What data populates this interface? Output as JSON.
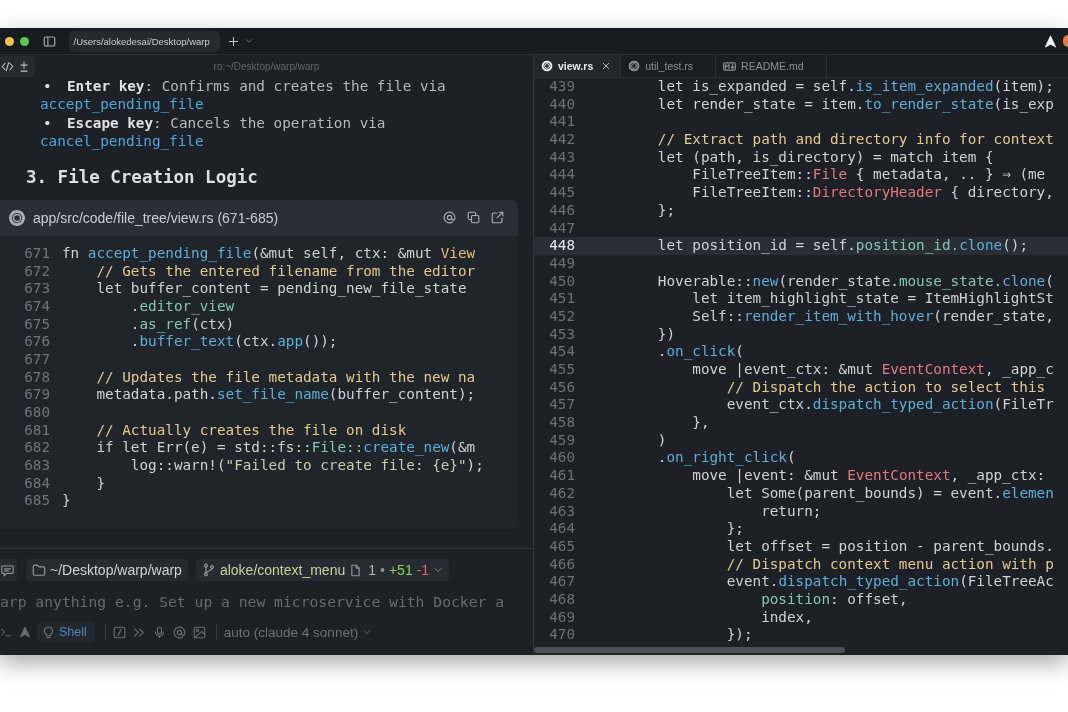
{
  "title_bar": {
    "tab_title": "/Users/alokedesai/Desktop/warp"
  },
  "left_pane": {
    "title": "ro:~/Desktop/warp/warp",
    "bullets": [
      {
        "marker": "•",
        "text": "**Enter key**: Confirms and creates the file via",
        "code": "accept_pending_file"
      },
      {
        "marker": "•",
        "text": "**Escape key**: Cancels the operation via",
        "code": "cancel_pending_file"
      }
    ],
    "heading": "3. File Creation Logic",
    "code_block": {
      "path": "app/src/code/file_tree/view.rs (671-685)",
      "lines": [
        {
          "number": "671",
          "tokens": [
            {
              "kind": "plain",
              "text": "fn "
            },
            {
              "kind": "call",
              "text": "accept_pending_file"
            },
            {
              "kind": "plain",
              "text": "(&mut self, ctx: &mut "
            },
            {
              "kind": "struct",
              "text": "View"
            }
          ]
        },
        {
          "number": "672",
          "tokens": [
            {
              "kind": "comment",
              "text": "    // Gets the entered filename from the editor"
            }
          ]
        },
        {
          "number": "673",
          "tokens": [
            {
              "kind": "plain",
              "text": "    let buffer_content = pending_new_file_state"
            }
          ]
        },
        {
          "number": "674",
          "tokens": [
            {
              "kind": "plain",
              "text": "        ."
            },
            {
              "kind": "field",
              "text": "editor_view"
            }
          ]
        },
        {
          "number": "675",
          "tokens": [
            {
              "kind": "plain",
              "text": "        ."
            },
            {
              "kind": "field",
              "text": "as_ref"
            },
            {
              "kind": "plain",
              "text": "(ctx)"
            }
          ]
        },
        {
          "number": "676",
          "tokens": [
            {
              "kind": "plain",
              "text": "        ."
            },
            {
              "kind": "call",
              "text": "buffer_text"
            },
            {
              "kind": "plain",
              "text": "(ctx."
            },
            {
              "kind": "call",
              "text": "app"
            },
            {
              "kind": "plain",
              "text": "());"
            }
          ]
        },
        {
          "number": "677"
        },
        {
          "number": "678",
          "tokens": [
            {
              "kind": "comment",
              "text": "    // Updates the file metadata with the new na"
            }
          ]
        },
        {
          "number": "679",
          "tokens": [
            {
              "kind": "plain",
              "text": "    metadata.path."
            },
            {
              "kind": "call",
              "text": "set_file_name"
            },
            {
              "kind": "plain",
              "text": "(buffer_content);"
            }
          ]
        },
        {
          "number": "680"
        },
        {
          "number": "681",
          "tokens": [
            {
              "kind": "comment",
              "text": "    // Actually creates the file on disk"
            }
          ]
        },
        {
          "number": "682",
          "tokens": [
            {
              "kind": "plain",
              "text": "    if let Err(e) = std::fs::"
            },
            {
              "kind": "field",
              "text": "File::"
            },
            {
              "kind": "call",
              "text": "create_new"
            },
            {
              "kind": "plain",
              "text": "(&m"
            }
          ]
        },
        {
          "number": "683",
          "tokens": [
            {
              "kind": "plain",
              "text": "        log::warn!("
            },
            {
              "kind": "string",
              "text": "\"Failed to create file: {e}\""
            },
            {
              "kind": "plain",
              "text": ");"
            }
          ]
        },
        {
          "number": "684",
          "tokens": [
            {
              "kind": "plain",
              "text": "    }"
            }
          ]
        },
        {
          "number": "685",
          "tokens": [
            {
              "kind": "plain",
              "text": "}"
            }
          ]
        }
      ]
    }
  },
  "prompt": {
    "directory": "~/Desktop/warp/warp",
    "git": {
      "branch": "aloke/context_menu",
      "files_changed": "1",
      "separator": "•",
      "additions": "+51",
      "deletions": "-1"
    },
    "placeholder": "arp anything e.g. Set up a new microservice with Docker a",
    "mode": "Shell",
    "model": "auto (claude 4 sonnet)"
  },
  "editor": {
    "tabs": [
      {
        "label": "view.rs",
        "selected": true,
        "kind": "rust"
      },
      {
        "label": "util_test.rs",
        "selected": false,
        "kind": "rust"
      },
      {
        "label": "README.md",
        "selected": false,
        "kind": "markdown"
      }
    ],
    "lines": [
      {
        "number": "439",
        "current": false,
        "tokens": [
          {
            "kind": "plain",
            "text": "        let is_expanded = self."
          },
          {
            "kind": "call",
            "text": "is_item_expanded"
          },
          {
            "kind": "plain",
            "text": "(item);"
          }
        ]
      },
      {
        "number": "440",
        "current": false,
        "tokens": [
          {
            "kind": "plain",
            "text": "        let render_state = item."
          },
          {
            "kind": "call",
            "text": "to_render_state"
          },
          {
            "kind": "plain",
            "text": "(is_exp"
          }
        ]
      },
      {
        "number": "441",
        "current": false
      },
      {
        "number": "442",
        "current": false,
        "tokens": [
          {
            "kind": "comment",
            "text": "        // Extract path and directory info for context"
          }
        ]
      },
      {
        "number": "443",
        "current": false,
        "tokens": [
          {
            "kind": "plain",
            "text": "        let (path, is_directory) = match item {"
          }
        ]
      },
      {
        "number": "444",
        "current": false,
        "tokens": [
          {
            "kind": "plain",
            "text": "            FileTreeItem::"
          },
          {
            "kind": "type",
            "text": "File"
          },
          {
            "kind": "plain",
            "text": " { metadata, .. } ⇒ (me"
          }
        ]
      },
      {
        "number": "445",
        "current": false,
        "tokens": [
          {
            "kind": "plain",
            "text": "            FileTreeItem::"
          },
          {
            "kind": "type",
            "text": "DirectoryHeader"
          },
          {
            "kind": "plain",
            "text": " { directory,"
          }
        ]
      },
      {
        "number": "446",
        "current": false,
        "tokens": [
          {
            "kind": "plain",
            "text": "        };"
          }
        ]
      },
      {
        "number": "447",
        "current": false
      },
      {
        "number": "448",
        "current": true,
        "tokens": [
          {
            "kind": "plain",
            "text": "        let position_id = self."
          },
          {
            "kind": "field",
            "text": "position_id."
          },
          {
            "kind": "call",
            "text": "clone"
          },
          {
            "kind": "plain",
            "text": "();"
          }
        ]
      },
      {
        "number": "449",
        "current": false
      },
      {
        "number": "450",
        "current": false,
        "tokens": [
          {
            "kind": "plain",
            "text": "        Hoverable::"
          },
          {
            "kind": "call",
            "text": "new"
          },
          {
            "kind": "plain",
            "text": "(render_state."
          },
          {
            "kind": "field",
            "text": "mouse_state."
          },
          {
            "kind": "call",
            "text": "clone"
          },
          {
            "kind": "plain",
            "text": "("
          }
        ]
      },
      {
        "number": "451",
        "current": false,
        "tokens": [
          {
            "kind": "plain",
            "text": "            let item_highlight_state = ItemHighlightSt"
          }
        ]
      },
      {
        "number": "452",
        "current": false,
        "tokens": [
          {
            "kind": "plain",
            "text": "            Self::"
          },
          {
            "kind": "call",
            "text": "render_item_with_hover"
          },
          {
            "kind": "plain",
            "text": "(render_state,"
          }
        ]
      },
      {
        "number": "453",
        "current": false,
        "tokens": [
          {
            "kind": "plain",
            "text": "        })"
          }
        ]
      },
      {
        "number": "454",
        "current": false,
        "tokens": [
          {
            "kind": "plain",
            "text": "        ."
          },
          {
            "kind": "call",
            "text": "on_click"
          },
          {
            "kind": "plain",
            "text": "("
          }
        ]
      },
      {
        "number": "455",
        "current": false,
        "tokens": [
          {
            "kind": "plain",
            "text": "            move |event_ctx: &mut "
          },
          {
            "kind": "type",
            "text": "EventContext"
          },
          {
            "kind": "plain",
            "text": ", _app_c"
          }
        ]
      },
      {
        "number": "456",
        "current": false,
        "tokens": [
          {
            "kind": "comment",
            "text": "                // Dispatch the action to select this"
          }
        ]
      },
      {
        "number": "457",
        "current": false,
        "tokens": [
          {
            "kind": "plain",
            "text": "                event_ctx."
          },
          {
            "kind": "call",
            "text": "dispatch_typed_action"
          },
          {
            "kind": "plain",
            "text": "(FileTr"
          }
        ]
      },
      {
        "number": "458",
        "current": false,
        "tokens": [
          {
            "kind": "plain",
            "text": "            },"
          }
        ]
      },
      {
        "number": "459",
        "current": false,
        "tokens": [
          {
            "kind": "plain",
            "text": "        )"
          }
        ]
      },
      {
        "number": "460",
        "current": false,
        "tokens": [
          {
            "kind": "plain",
            "text": "        ."
          },
          {
            "kind": "call",
            "text": "on_right_click"
          },
          {
            "kind": "plain",
            "text": "("
          }
        ]
      },
      {
        "number": "461",
        "current": false,
        "tokens": [
          {
            "kind": "plain",
            "text": "            move |event: &mut "
          },
          {
            "kind": "type",
            "text": "EventContext"
          },
          {
            "kind": "plain",
            "text": ", _app_ctx:"
          }
        ]
      },
      {
        "number": "462",
        "current": false,
        "tokens": [
          {
            "kind": "plain",
            "text": "                let Some(parent_bounds) = event."
          },
          {
            "kind": "call",
            "text": "elemen"
          }
        ]
      },
      {
        "number": "463",
        "current": false,
        "tokens": [
          {
            "kind": "plain",
            "text": "                    return;"
          }
        ]
      },
      {
        "number": "464",
        "current": false,
        "tokens": [
          {
            "kind": "plain",
            "text": "                };"
          }
        ]
      },
      {
        "number": "465",
        "current": false,
        "tokens": [
          {
            "kind": "plain",
            "text": "                let offset = position - parent_bounds."
          }
        ]
      },
      {
        "number": "466",
        "current": false,
        "tokens": [
          {
            "kind": "comment",
            "text": "                // Dispatch context menu action with p"
          }
        ]
      },
      {
        "number": "467",
        "current": false,
        "tokens": [
          {
            "kind": "plain",
            "text": "                event."
          },
          {
            "kind": "call",
            "text": "dispatch_typed_action"
          },
          {
            "kind": "plain",
            "text": "(FileTreeAc"
          }
        ]
      },
      {
        "number": "468",
        "current": false,
        "tokens": [
          {
            "kind": "field",
            "text": "                    position"
          },
          {
            "kind": "plain",
            "text": ": offset,"
          }
        ]
      },
      {
        "number": "469",
        "current": false,
        "tokens": [
          {
            "kind": "plain",
            "text": "                    index,"
          }
        ]
      },
      {
        "number": "470",
        "current": false,
        "tokens": [
          {
            "kind": "plain",
            "text": "                });"
          }
        ]
      }
    ]
  }
}
